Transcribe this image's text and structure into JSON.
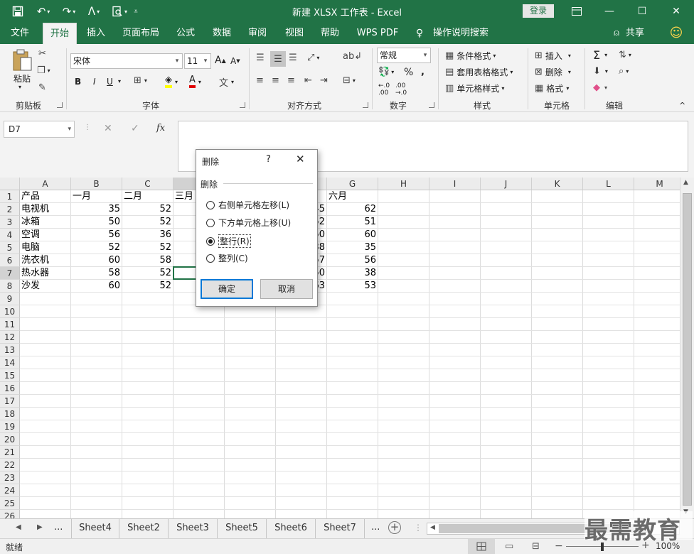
{
  "titlebar": {
    "title": "新建 XLSX 工作表 - Excel",
    "login": "登录"
  },
  "menubar": {
    "tabs": [
      "文件",
      "开始",
      "插入",
      "页面布局",
      "公式",
      "数据",
      "审阅",
      "视图",
      "帮助",
      "WPS PDF",
      "操作说明搜索"
    ],
    "active_tab": "开始",
    "share": "共享"
  },
  "ribbon": {
    "clipboard": {
      "paste": "粘贴",
      "label": "剪贴板"
    },
    "font": {
      "name": "宋体",
      "size": "11",
      "label": "字体",
      "bold": "B",
      "italic": "I",
      "underline": "U"
    },
    "alignment": {
      "label": "对齐方式"
    },
    "number": {
      "format": "常规",
      "label": "数字"
    },
    "styles": {
      "conditional": "条件格式",
      "table": "套用表格格式",
      "cell": "单元格样式",
      "label": "样式"
    },
    "cells": {
      "insert": "插入",
      "delete": "删除",
      "format": "格式",
      "label": "单元格"
    },
    "editing": {
      "label": "编辑"
    }
  },
  "formulabar": {
    "namebox": "D7",
    "fx": "fx",
    "formula": ""
  },
  "grid": {
    "columns": [
      "A",
      "B",
      "C",
      "D",
      "E",
      "F",
      "G",
      "H",
      "I",
      "J",
      "K",
      "L",
      "M"
    ],
    "rows": [
      "1",
      "2",
      "3",
      "4",
      "5",
      "6",
      "7",
      "8",
      "9",
      "10",
      "11",
      "12",
      "13",
      "14",
      "15",
      "16",
      "17",
      "18",
      "19",
      "20",
      "21",
      "22",
      "23",
      "24",
      "25",
      "26"
    ],
    "headers": [
      "产品",
      "一月",
      "二月",
      "三月",
      "",
      "",
      "六月"
    ],
    "data": [
      [
        "电视机",
        "35",
        "52",
        "",
        "",
        "45",
        "62"
      ],
      [
        "冰箱",
        "50",
        "52",
        "",
        "",
        "52",
        "51"
      ],
      [
        "空调",
        "56",
        "36",
        "",
        "",
        "50",
        "60"
      ],
      [
        "电脑",
        "52",
        "52",
        "",
        "",
        "38",
        "35"
      ],
      [
        "洗衣机",
        "60",
        "58",
        "",
        "",
        "57",
        "56"
      ],
      [
        "热水器",
        "58",
        "52",
        "",
        "",
        "50",
        "38"
      ],
      [
        "沙发",
        "60",
        "52",
        "",
        "",
        "63",
        "53"
      ]
    ]
  },
  "sheet_tabs": [
    "Sheet4",
    "Sheet5",
    "Sheet3",
    "Sheet5",
    "Sheet6",
    "Sheet7"
  ],
  "sheet_tabs_labels": [
    "Sheet4",
    "Sheet2",
    "Sheet3",
    "Sheet5",
    "Sheet6",
    "Sheet7"
  ],
  "status": {
    "ready": "就绪",
    "zoom": "100%"
  },
  "dialog": {
    "title": "删除",
    "help": "?",
    "group": "删除",
    "options": [
      "右侧单元格左移(L)",
      "下方单元格上移(U)",
      "整行(R)",
      "整列(C)"
    ],
    "selected": "整行(R)",
    "ok": "确定",
    "cancel": "取消"
  },
  "watermark": "最需教育",
  "colors": {
    "excel_green": "#217346",
    "ribbon_bg": "#f3f3f3",
    "selection": "#217346"
  }
}
